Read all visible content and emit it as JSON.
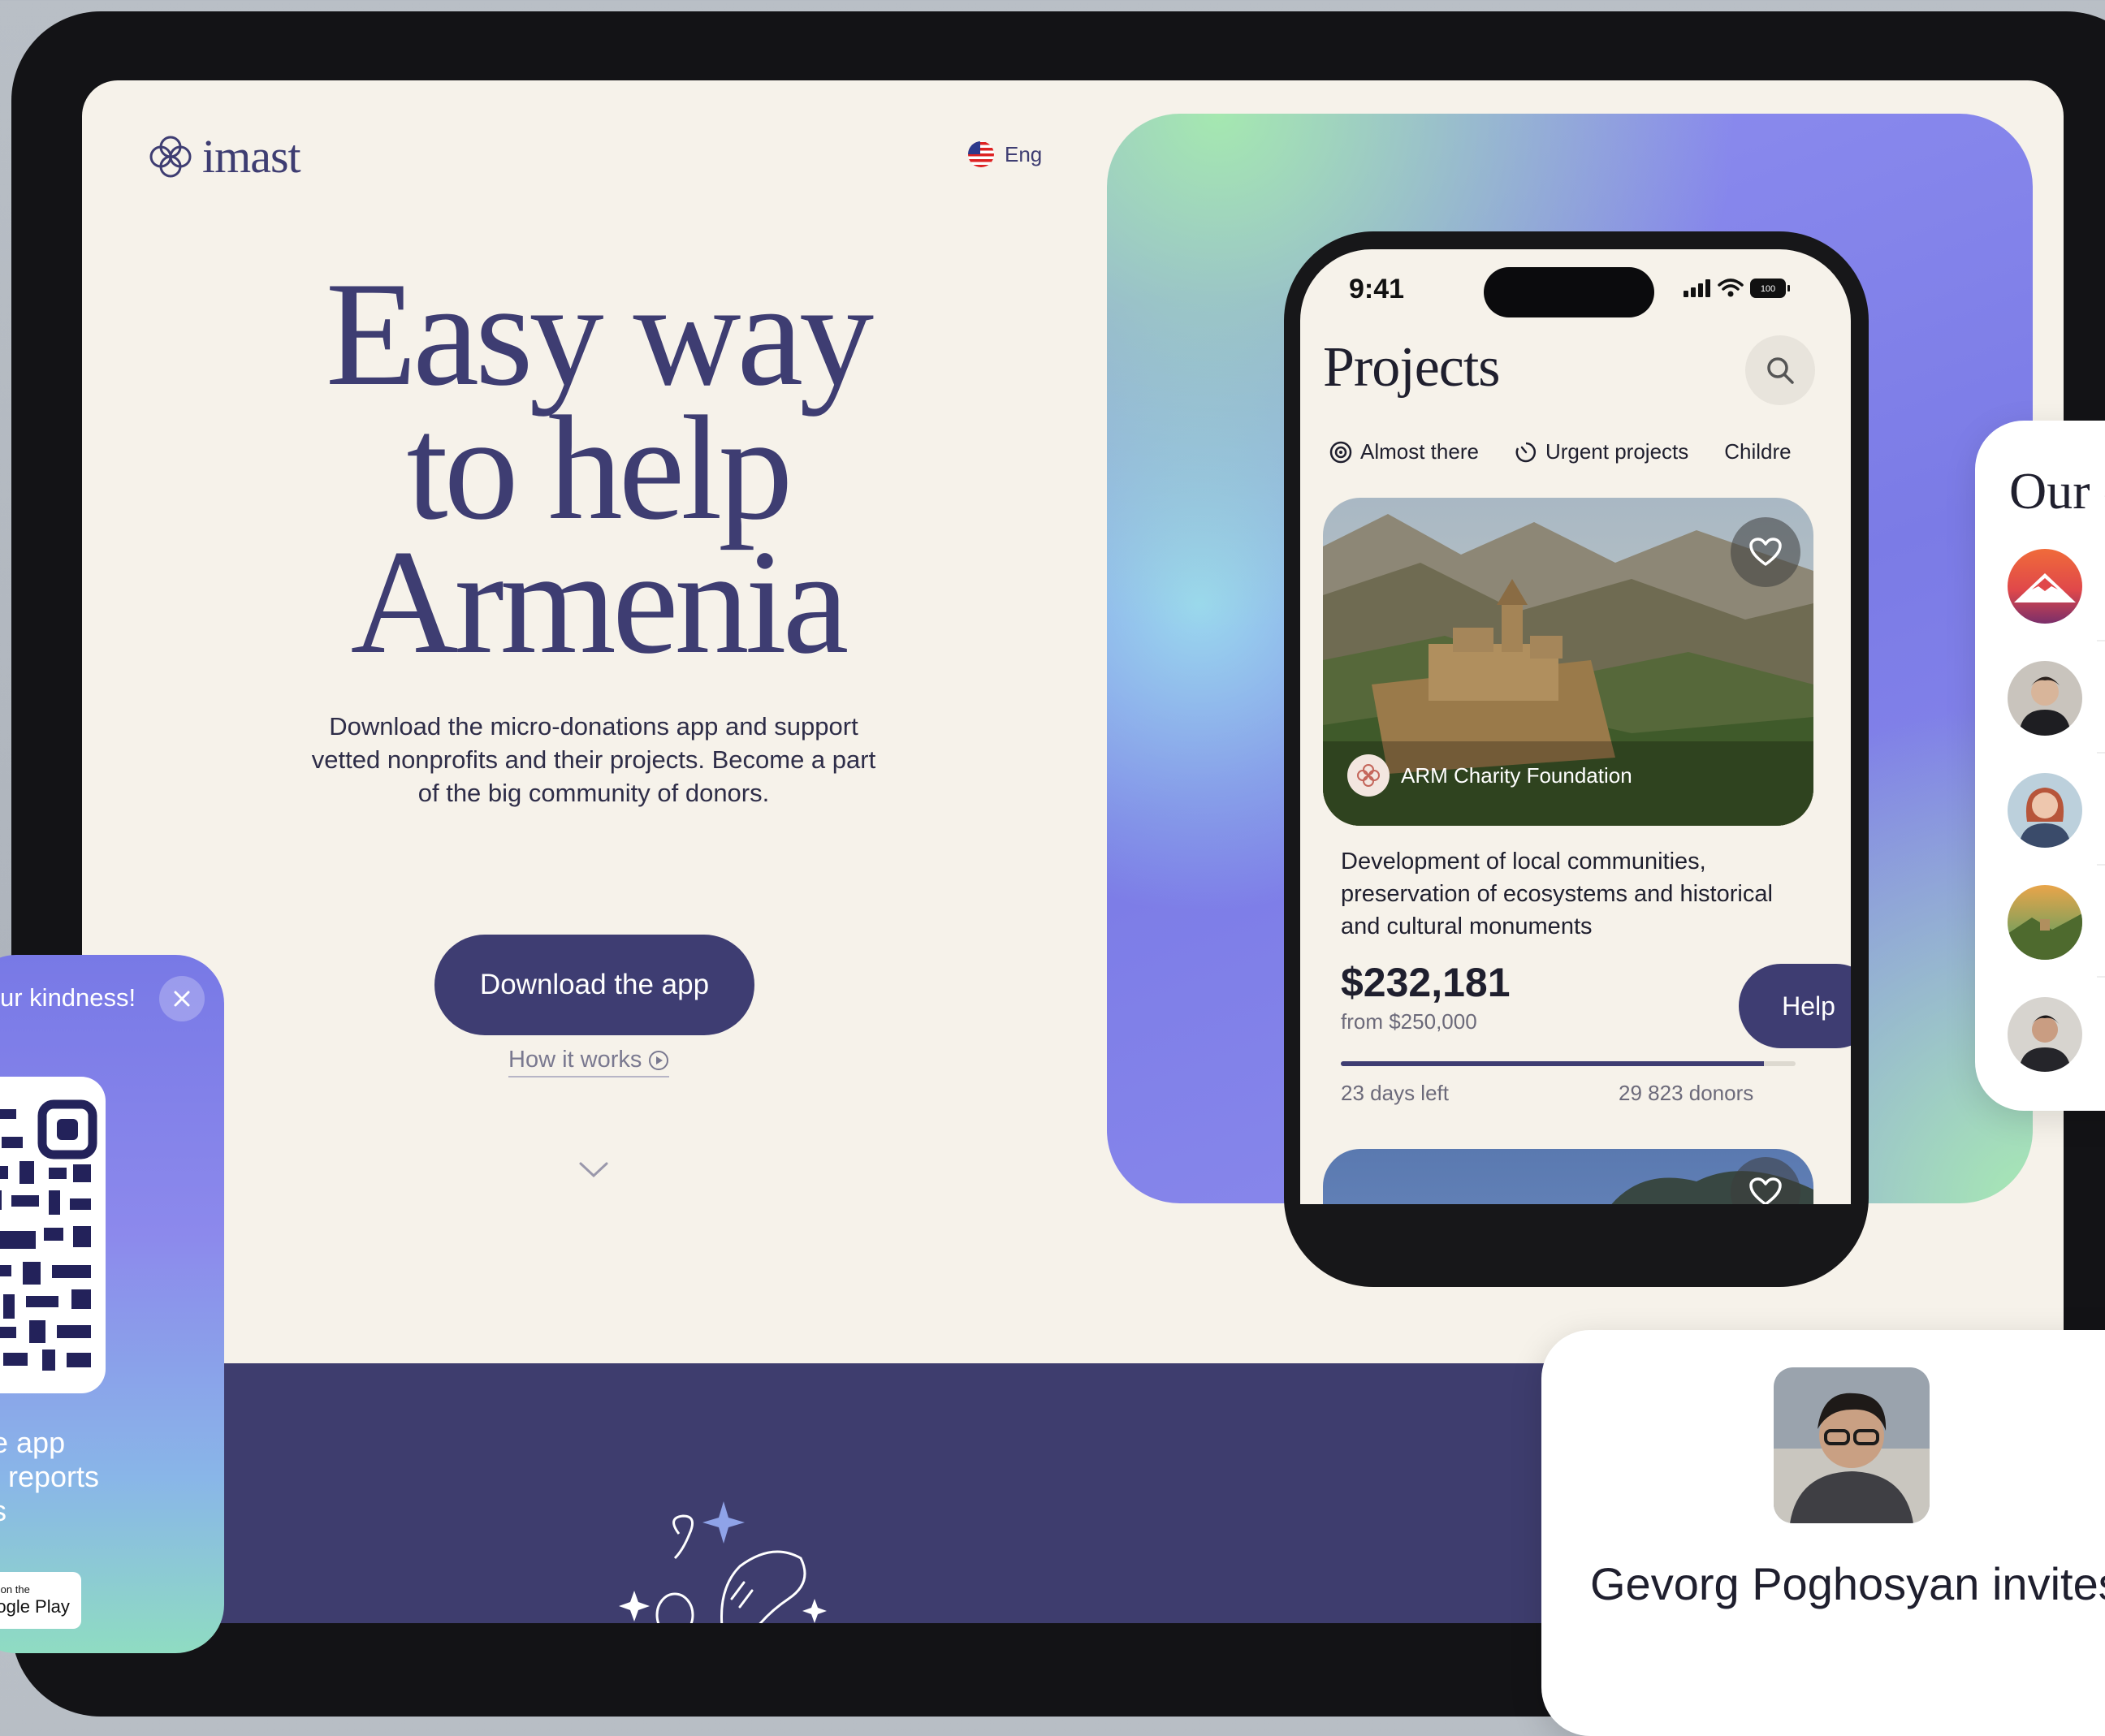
{
  "brand": {
    "name": "imast"
  },
  "header": {
    "language": "Eng"
  },
  "hero": {
    "title_line1": "Easy way",
    "title_line2": "to help",
    "title_line3": "Armenia",
    "subtitle": "Download the micro-donations app and support vetted nonprofits and their projects. Become a part of the big community of donors.",
    "download_label": "Download the app",
    "how_label": "How it works"
  },
  "phone": {
    "time": "9:41",
    "battery": "100",
    "title": "Projects",
    "filters": [
      "Almost there",
      "Urgent projects",
      "Childre"
    ],
    "project": {
      "organization": "ARM Charity Foundation",
      "description": "Development of local communities, preservation of ecosystems and historical and cultural monuments",
      "amount": "$232,181",
      "goal": "from $250,000",
      "progress_fraction": 0.93,
      "help_label": "Help",
      "days_left": "23 days left",
      "donors": "29 823 donors"
    }
  },
  "side_card": {
    "title_partial": "Our c"
  },
  "qr_card": {
    "title_partial": "ur kindness!",
    "text_line1": "e app",
    "text_line2": "t reports",
    "text_line3": "s",
    "store_small": "Get it on the",
    "store_big": "Google Play"
  },
  "invite_card": {
    "text": "Gevorg Poghosyan invites"
  },
  "colors": {
    "brand_navy": "#3e3d72",
    "background_cream": "#f6f2ea",
    "band_purple": "#3e3d6e"
  }
}
